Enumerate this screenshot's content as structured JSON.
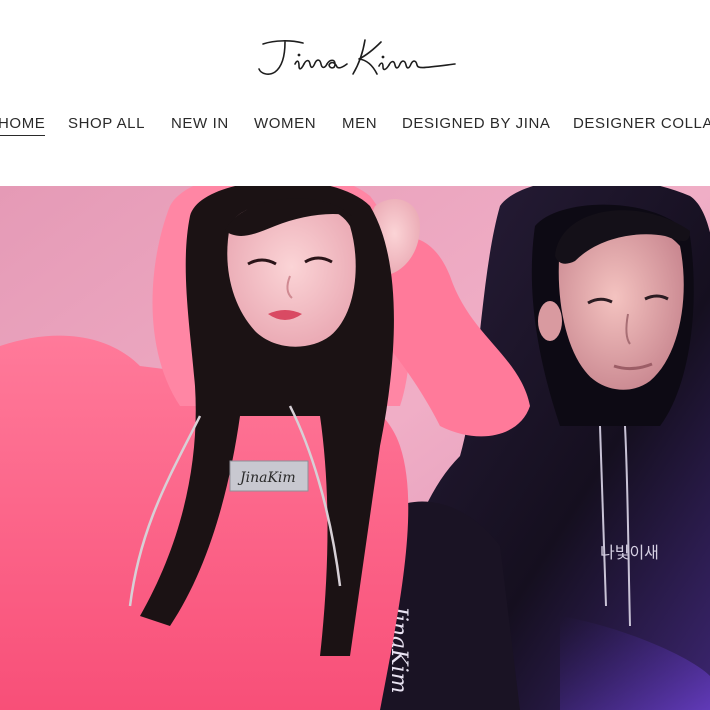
{
  "logo": {
    "text": "JinaKim"
  },
  "nav": {
    "items": [
      {
        "label": "HOME",
        "active": true
      },
      {
        "label": "SHOP ALL",
        "active": false
      },
      {
        "label": "NEW IN",
        "active": false
      },
      {
        "label": "WOMEN",
        "active": false
      },
      {
        "label": "MEN",
        "active": false
      },
      {
        "label": "DESIGNED BY JINA",
        "active": false
      },
      {
        "label": "DESIGNER COLLA",
        "active": false
      }
    ]
  },
  "hero": {
    "patch_text": "JinaKim",
    "print_text": "나빛이새",
    "sleeve_text": "JinaKim",
    "colors": {
      "background": "#e7a0bd",
      "pink_hoodie": "#fb5f84",
      "black_hoodie": "#1a1424",
      "purple_light": "#5b3aa8"
    }
  }
}
